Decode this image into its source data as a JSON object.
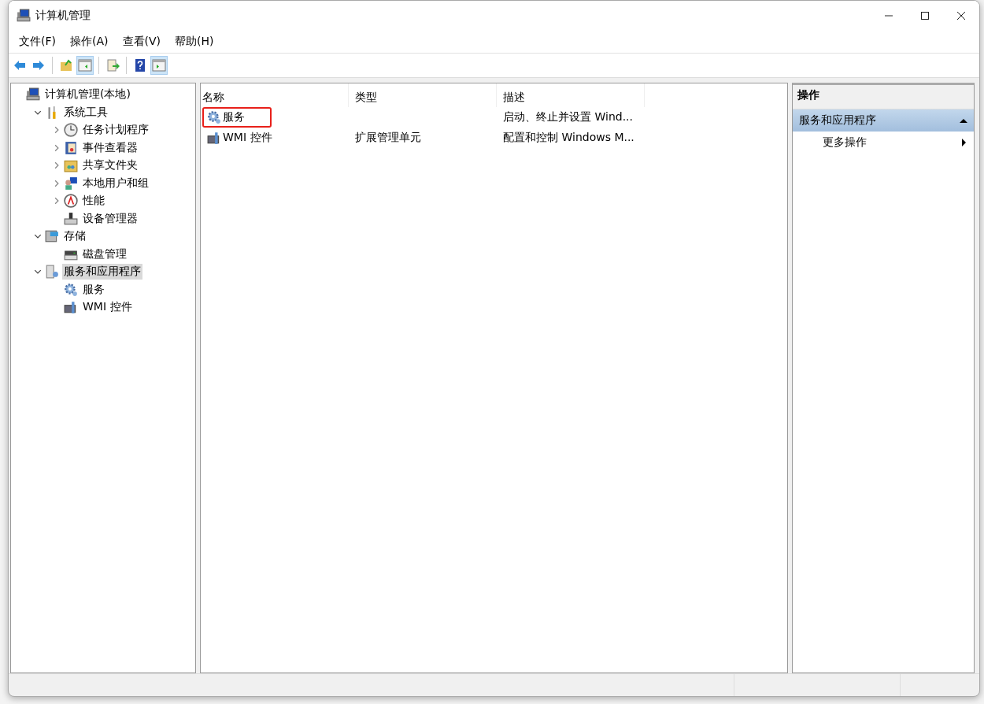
{
  "window": {
    "title": "计算机管理"
  },
  "menu": [
    {
      "label": "文件(F)"
    },
    {
      "label": "操作(A)"
    },
    {
      "label": "查看(V)"
    },
    {
      "label": "帮助(H)"
    }
  ],
  "toolbar": [
    {
      "kind": "back",
      "pressed": false
    },
    {
      "kind": "forward",
      "pressed": false
    },
    {
      "kind": "sep"
    },
    {
      "kind": "up",
      "pressed": false
    },
    {
      "kind": "tree",
      "pressed": true
    },
    {
      "kind": "sep"
    },
    {
      "kind": "export",
      "pressed": false
    },
    {
      "kind": "sep"
    },
    {
      "kind": "help",
      "pressed": false
    },
    {
      "kind": "actionpane",
      "pressed": true
    }
  ],
  "tree": [
    {
      "label": "计算机管理(本地)",
      "kind": "computer",
      "selected": false,
      "children": [
        {
          "label": "系统工具",
          "kind": "tools",
          "expanded": true,
          "selected": false,
          "children": [
            {
              "label": "任务计划程序",
              "kind": "clock",
              "expanded": false,
              "selected": false
            },
            {
              "label": "事件查看器",
              "kind": "event",
              "expanded": false,
              "selected": false
            },
            {
              "label": "共享文件夹",
              "kind": "share",
              "expanded": false,
              "selected": false
            },
            {
              "label": "本地用户和组",
              "kind": "users",
              "expanded": false,
              "selected": false
            },
            {
              "label": "性能",
              "kind": "perf",
              "expanded": false,
              "selected": false
            },
            {
              "label": "设备管理器",
              "kind": "device",
              "selected": false
            }
          ]
        },
        {
          "label": "存储",
          "kind": "storage",
          "expanded": true,
          "selected": false,
          "children": [
            {
              "label": "磁盘管理",
              "kind": "disk",
              "selected": false
            }
          ]
        },
        {
          "label": "服务和应用程序",
          "kind": "server",
          "expanded": true,
          "selected": true,
          "children": [
            {
              "label": "服务",
              "kind": "gear",
              "selected": false
            },
            {
              "label": "WMI 控件",
              "kind": "wmi",
              "selected": false
            }
          ]
        }
      ]
    }
  ],
  "list": {
    "columns": [
      "名称",
      "类型",
      "描述"
    ],
    "rows": [
      {
        "name": "服务",
        "kind": "gear",
        "type": "",
        "description": "启动、终止并设置 Wind...",
        "highlighted": true
      },
      {
        "name": "WMI 控件",
        "kind": "wmi",
        "type": "扩展管理单元",
        "description": "配置和控制 Windows M...",
        "highlighted": false
      }
    ]
  },
  "actions": {
    "title": "操作",
    "sections": [
      {
        "label": "服务和应用程序",
        "expanded": true,
        "items": [
          {
            "label": "更多操作"
          }
        ]
      }
    ]
  }
}
